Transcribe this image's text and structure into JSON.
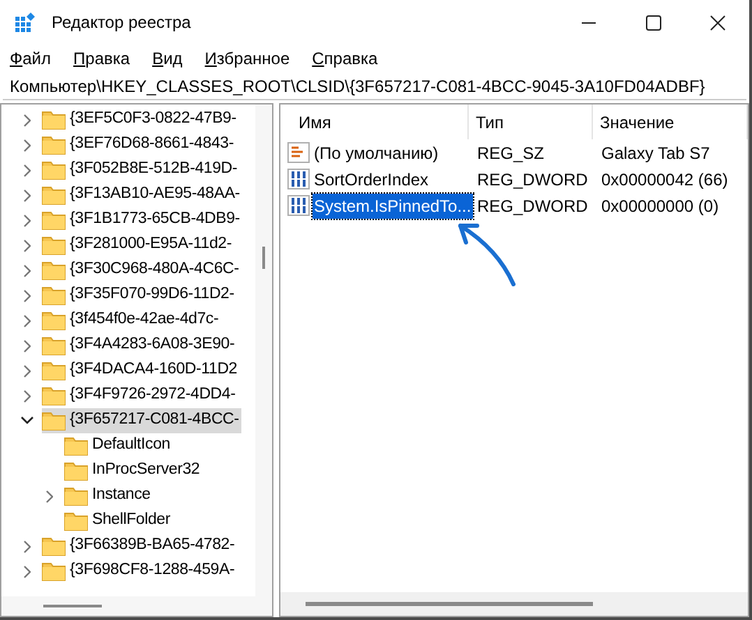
{
  "window": {
    "title": "Редактор реестра"
  },
  "menu": [
    {
      "label": "Файл"
    },
    {
      "label": "Правка"
    },
    {
      "label": "Вид"
    },
    {
      "label": "Избранное"
    },
    {
      "label": "Справка"
    }
  ],
  "address": "Компьютер\\HKEY_CLASSES_ROOT\\CLSID\\{3F657217-C081-4BCC-9045-3A10FD04ADBF}",
  "tree": [
    {
      "label": "{3EF5C0F3-0822-47B9-",
      "expanded": false,
      "selected": false
    },
    {
      "label": "{3EF76D68-8661-4843-",
      "expanded": false,
      "selected": false
    },
    {
      "label": "{3F052B8E-512B-419D-",
      "expanded": false,
      "selected": false
    },
    {
      "label": "{3F13AB10-AE95-48AA-",
      "expanded": false,
      "selected": false
    },
    {
      "label": "{3F1B1773-65CB-4DB9-",
      "expanded": false,
      "selected": false
    },
    {
      "label": "{3F281000-E95A-11d2-",
      "expanded": false,
      "selected": false
    },
    {
      "label": "{3F30C968-480A-4C6C-",
      "expanded": false,
      "selected": false
    },
    {
      "label": "{3F35F070-99D6-11D2-",
      "expanded": false,
      "selected": false
    },
    {
      "label": "{3f454f0e-42ae-4d7c-",
      "expanded": false,
      "selected": false
    },
    {
      "label": "{3F4A4283-6A08-3E90-",
      "expanded": false,
      "selected": false
    },
    {
      "label": "{3F4DACA4-160D-11D2",
      "expanded": false,
      "selected": false
    },
    {
      "label": "{3F4F9726-2972-4DD4-",
      "expanded": false,
      "selected": false
    },
    {
      "label": "{3F657217-C081-4BCC-",
      "expanded": true,
      "selected": true,
      "children": [
        {
          "label": "DefaultIcon",
          "expandable": false,
          "selected": false
        },
        {
          "label": "InProcServer32",
          "expandable": false,
          "selected": false
        },
        {
          "label": "Instance",
          "expandable": true,
          "selected": false
        },
        {
          "label": "ShellFolder",
          "expandable": false,
          "selected": false
        }
      ]
    },
    {
      "label": "{3F66389B-BA65-4782-",
      "expanded": false,
      "selected": false
    },
    {
      "label": "{3F698CF8-1288-459A-",
      "expanded": false,
      "selected": false
    }
  ],
  "values": {
    "columns": [
      "Имя",
      "Тип",
      "Значение"
    ],
    "rows": [
      {
        "kind": "string",
        "name": "(По умолчанию)",
        "type": "REG_SZ",
        "data": "Galaxy Tab S7",
        "selected": false
      },
      {
        "kind": "binary",
        "name": "SortOrderIndex",
        "type": "REG_DWORD",
        "data": "0x00000042 (66)",
        "selected": false
      },
      {
        "kind": "binary",
        "name": "System.IsPinnedTo...",
        "type": "REG_DWORD",
        "data": "0x00000000 (0)",
        "selected": true
      }
    ]
  }
}
